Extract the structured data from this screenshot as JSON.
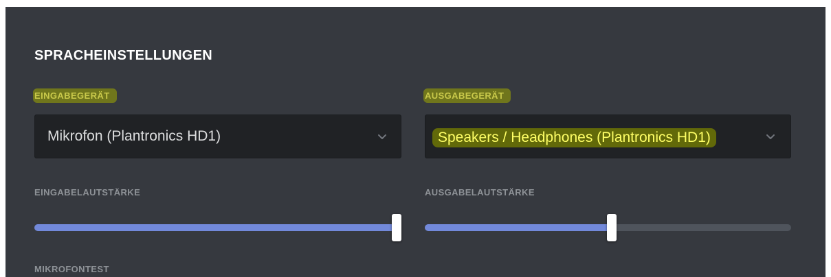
{
  "voice_settings": {
    "title": "SPRACHEINSTELLUNGEN",
    "input_device": {
      "label": "EINGABEGERÄT",
      "value": "Mikrofon (Plantronics HD1)",
      "icon": "chevron-down-icon"
    },
    "output_device": {
      "label": "AUSGABEGERÄT",
      "value": "Speakers / Headphones (Plantronics HD1)",
      "icon": "chevron-down-icon"
    },
    "input_volume": {
      "label": "EINGABELAUTSTÄRKE",
      "level": 1.0
    },
    "output_volume": {
      "label": "AUSGABELAUTSTÄRKE",
      "level": 0.51
    },
    "mic_test": {
      "label": "MIKROFONTEST"
    }
  },
  "colors": {
    "background": "#36393f",
    "select_background": "#202225",
    "label": "#8e9297",
    "slider_fill": "#7289da",
    "slider_track": "#4f545c",
    "highlight": "#a0aa00"
  }
}
